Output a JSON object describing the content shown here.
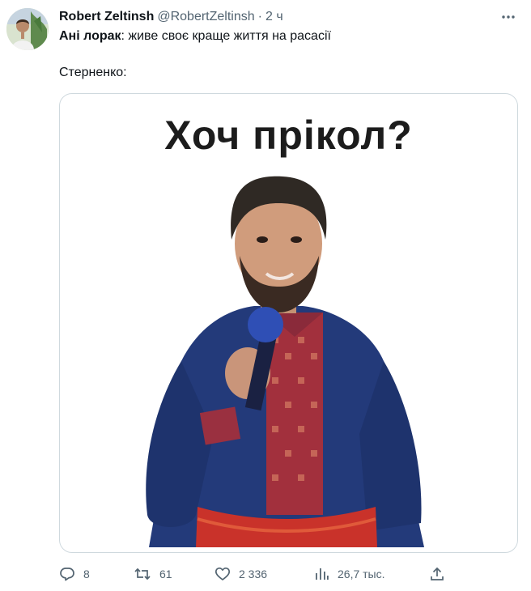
{
  "tweet": {
    "author_name": "Robert Zeltinsh",
    "author_handle": "@RobertZeltinsh",
    "separator": "·",
    "time": "2 ч",
    "line1_bold": "Ані лорак",
    "line1_rest": ": живе своє краще життя на расасії",
    "line2": "Стерненко:",
    "image_caption": "Хоч прікол?"
  },
  "actions": {
    "replies": "8",
    "retweets": "61",
    "likes": "2 336",
    "views": "26,7 тыс."
  },
  "icons": {
    "more": "more-horizontal-icon",
    "reply": "reply-icon",
    "retweet": "retweet-icon",
    "like": "heart-icon",
    "views": "views-chart-icon",
    "share": "share-icon"
  }
}
